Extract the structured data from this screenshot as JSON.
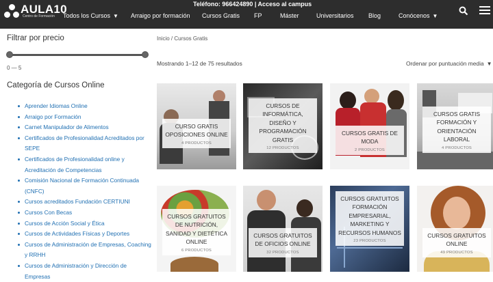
{
  "header": {
    "brand": "AULA10",
    "brand_sub": "Centro de Formación",
    "topline": "Teléfono: 966424890 | Acceso al campus",
    "nav": [
      {
        "label": "Todos los Cursos",
        "dropdown": true
      },
      {
        "label": "Arraigo por formación",
        "dropdown": false
      },
      {
        "label": "Cursos Gratis",
        "dropdown": false
      },
      {
        "label": "FP",
        "dropdown": false
      },
      {
        "label": "Máster",
        "dropdown": false
      },
      {
        "label": "Universitarios",
        "dropdown": false
      },
      {
        "label": "Blog",
        "dropdown": false
      },
      {
        "label": "Conócenos",
        "dropdown": true
      }
    ],
    "icons": [
      "search-icon",
      "menu-icon"
    ],
    "bar_color": "#2d2d2d"
  },
  "sidebar": {
    "filter_title": "Filtrar por precio",
    "range_text": "0 — 5",
    "category_title": "Categoría de Cursos Online",
    "categories": [
      "Aprender Idiomas Online",
      "Arraigo por Formación",
      "Carnet Manipulador de Alimentos",
      "Certificados de Profesionalidad Acreditados por SEPE",
      "Certificados de Profesionalidad online y Acreditación de Competencias",
      "Comisión Nacional de Formación Continuada (CNFC)",
      "Cursos acreditados Fundación CERTIUNI",
      "Cursos Con Becas",
      "Cursos de Acción Social y Ética",
      "Cursos de Actividades Físicas y Deportes",
      "Cursos de Administración de Empresas, Coaching y RRHH",
      "Cursos de Administración y Dirección de Empresas"
    ],
    "link_color": "#1f6fb2"
  },
  "main": {
    "breadcrumb": "Inicio / Cursos Gratis",
    "results": "Mostrando 1–12 de 75 resultados",
    "sort": "Ordenar por puntuación media",
    "products": [
      {
        "title": "CURSO GRATIS OPOSICIONES ONLINE",
        "count": "4 PRODUCTOS"
      },
      {
        "title": "CURSOS DE INFORMÁTICA, DISEÑO Y PROGRAMACIÓN GRATIS",
        "count": "12 PRODUCTOS"
      },
      {
        "title": "CURSOS GRATIS DE MODA",
        "count": "2 PRODUCTOS"
      },
      {
        "title": "CURSOS GRATIS FORMACIÓN Y ORIENTACIÓN LABORAL",
        "count": "4 PRODUCTOS"
      },
      {
        "title": "CURSOS GRATUITOS DE NUTRICIÓN, SANIDAD Y DIETÉTICA ONLINE",
        "count": "6 PRODUCTOS"
      },
      {
        "title": "CURSOS GRATUITOS DE OFICIOS ONLINE",
        "count": "32 PRODUCTOS"
      },
      {
        "title": "CURSOS GRATUITOS FORMACIÓN EMPRESARIAL, MARKETING Y RECURSOS HUMANOS",
        "count": "23 PRODUCTOS"
      },
      {
        "title": "CURSOS GRATUITOS ONLINE",
        "count": "49 PRODUCTOS"
      }
    ]
  }
}
